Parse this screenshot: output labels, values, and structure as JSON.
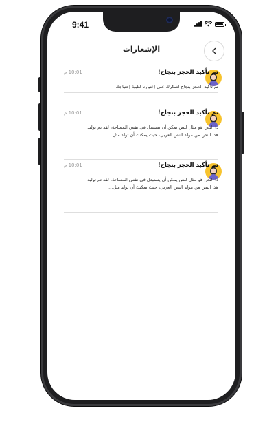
{
  "status_bar": {
    "time": "9:41"
  },
  "header": {
    "title": "الإشعارات",
    "back_icon": "chevron-left-icon"
  },
  "notifications": [
    {
      "title": "تم تأكيد الحجز بنجاح!",
      "time": "10:01 م",
      "body": "تم تأكيد الحجز بنجاح اشكرك على إختيارنا لتلبية إحتياجك."
    },
    {
      "title": "تم تأكيد الحجز بنجاح!",
      "time": "10:01 م",
      "body": "ذا النص هو مثال لنص يمكن أن يستبدل في نفس المساحة، لقد تم توليد هذا النص من مولد النص العربى، حيث يمكنك أن تولد مثل..."
    },
    {
      "title": "تم تأكيد الحجز بنجاح!",
      "time": "10:01 م",
      "body": "ذا النص هو مثال لنص يمكن أن يستبدل في نفس المساحة، لقد تم توليد هذا النص من مولد النص العربى، حيث يمكنك أن تولد مثل..."
    }
  ],
  "colors": {
    "avatar_bg": "#f7c32e",
    "avatar_shirt": "#6c63c9",
    "phone_frame": "#1e1e20",
    "divider": "#dedede"
  }
}
